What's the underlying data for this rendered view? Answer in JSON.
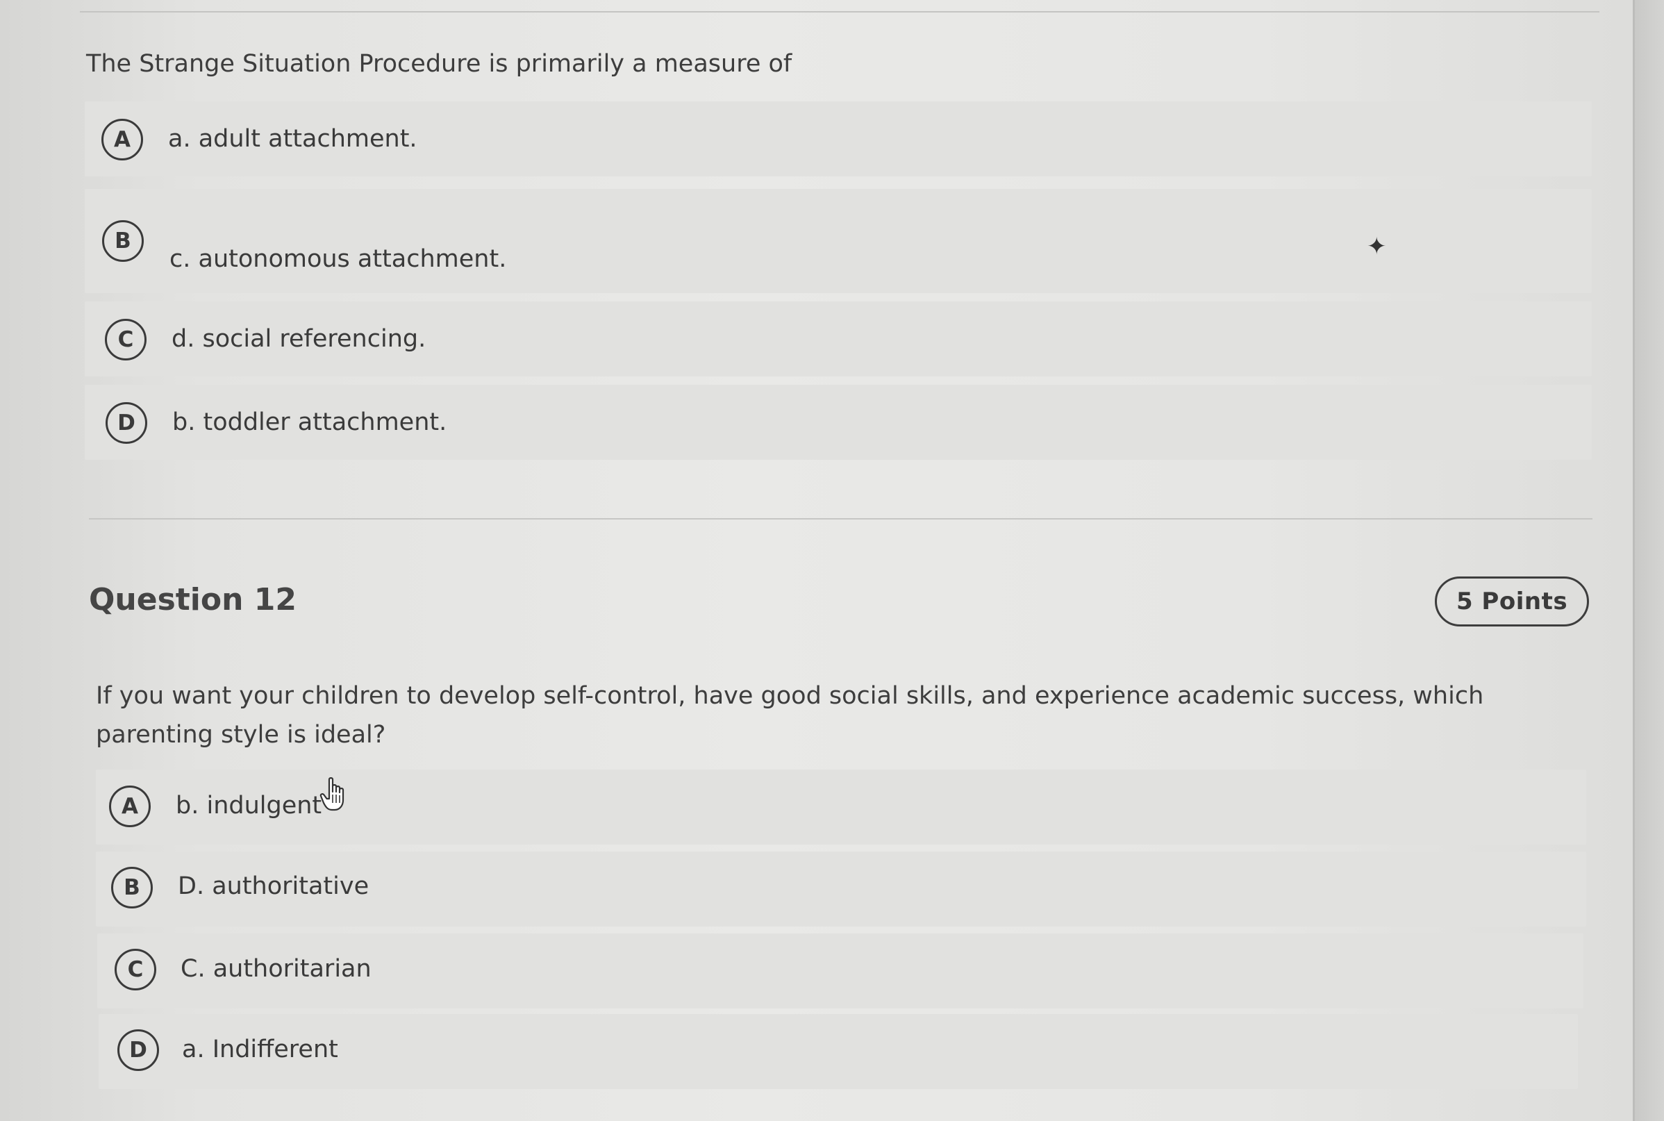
{
  "question11": {
    "text": "The Strange Situation Procedure is primarily a measure of",
    "options": [
      {
        "letter": "A",
        "label": "a. adult attachment."
      },
      {
        "letter": "B",
        "label": "c. autonomous attachment."
      },
      {
        "letter": "C",
        "label": "d. social referencing."
      },
      {
        "letter": "D",
        "label": "b. toddler attachment."
      }
    ]
  },
  "question12": {
    "heading": "Question 12",
    "points": "5 Points",
    "text": "If you want your children to develop self-control, have good social skills, and experience academic success, which parenting style is ideal?",
    "options": [
      {
        "letter": "A",
        "label": "b. indulgent"
      },
      {
        "letter": "B",
        "label": "D. authoritative"
      },
      {
        "letter": "C",
        "label": "C. authoritarian"
      },
      {
        "letter": "D",
        "label": "a. Indifferent"
      }
    ]
  },
  "icons": {
    "cursor": "hand-pointer-icon",
    "marker": "star-icon"
  },
  "colors": {
    "page_background": "#e6e6e4",
    "option_background": "#e1e1df",
    "text": "#3a3a3a"
  }
}
